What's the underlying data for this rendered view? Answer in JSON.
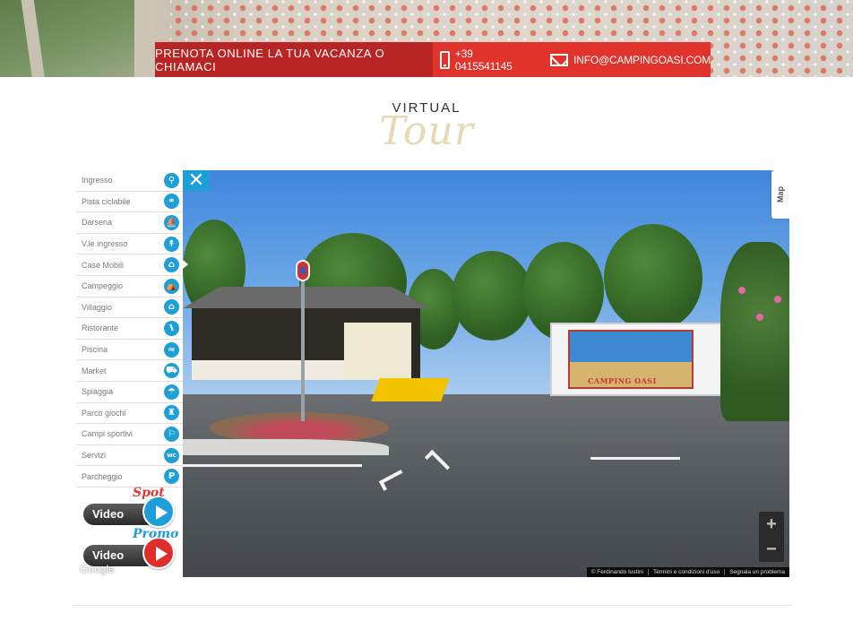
{
  "topbar": {
    "cta_text": "PRENOTA ONLINE LA TUA VACANZA O CHIAMACI",
    "phone": "+39 0415541145",
    "email": "INFO@CAMPINGOASI.COM",
    "colors": {
      "dark_red": "#b92424",
      "red": "#e0332c"
    }
  },
  "title": {
    "small": "VIRTUAL",
    "big": "Tour"
  },
  "sidebar": {
    "items": [
      {
        "label": "Ingresso",
        "icon": "location-pin-icon",
        "glyph": "⚲"
      },
      {
        "label": "Pista ciclabile",
        "icon": "bicycle-icon",
        "glyph": "⚭"
      },
      {
        "label": "Darsena",
        "icon": "sailboat-icon",
        "glyph": "⛵"
      },
      {
        "label": "V.le ingresso",
        "icon": "palm-tree-icon",
        "glyph": "↟"
      },
      {
        "label": "Case Mobili",
        "icon": "house-icon",
        "glyph": "⌂"
      },
      {
        "label": "Campeggio",
        "icon": "tent-icon",
        "glyph": "⛺"
      },
      {
        "label": "Villaggio",
        "icon": "house-icon",
        "glyph": "⌂"
      },
      {
        "label": "Ristorante",
        "icon": "fork-knife-icon",
        "glyph": "⑊"
      },
      {
        "label": "Piscina",
        "icon": "swimmer-icon",
        "glyph": "≈"
      },
      {
        "label": "Market",
        "icon": "shopping-cart-icon",
        "glyph": "⛟"
      },
      {
        "label": "Spiaggia",
        "icon": "beach-umbrella-icon",
        "glyph": "☂"
      },
      {
        "label": "Parco giochi",
        "icon": "castle-icon",
        "glyph": "♜"
      },
      {
        "label": "Campi sportivi",
        "icon": "runner-icon",
        "glyph": "⚐"
      },
      {
        "label": "Servizi",
        "icon": "wc-icon",
        "glyph": "wc"
      },
      {
        "label": "Parcheggio",
        "icon": "parking-icon",
        "glyph": "P"
      }
    ],
    "active_index": 4,
    "accent": "#1e9fd6"
  },
  "videos": {
    "spot": {
      "label": "Video",
      "tag": "Spot"
    },
    "promo": {
      "label": "Video",
      "tag": "Promo"
    }
  },
  "viewer": {
    "close_glyph": "✕",
    "map_tab": "Map",
    "zoom_in": "+",
    "zoom_out": "−",
    "google": "Google",
    "mural_text": "CAMPING OASI",
    "footer_links": [
      "© Ferdinando Iustini",
      "Termini e condizioni d'uso",
      "Segnala un problema"
    ]
  }
}
